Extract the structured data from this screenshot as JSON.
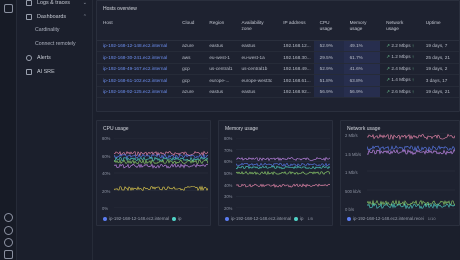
{
  "sidebar": {
    "items": [
      {
        "label": "Logs & traces",
        "chevron": "⌄"
      },
      {
        "label": "Dashboards",
        "chevron": "⌃"
      },
      {
        "label": "Cardinality"
      },
      {
        "label": "Connect remotely"
      },
      {
        "label": "Alerts"
      },
      {
        "label": "AI SRE"
      }
    ]
  },
  "hosts": {
    "title": "Hosts overview",
    "columns": [
      "Host",
      "Cloud",
      "Region",
      "Availability zone",
      "IP address",
      "CPU usage",
      "Memory usage",
      "Network usage",
      "Uptime"
    ],
    "rows": [
      {
        "host": "ip-192-168-12-148.ec2.internal",
        "cloud": "azure",
        "region": "eastus",
        "az": "eastus",
        "ip": "192.168.12...",
        "cpu": "52.9%",
        "mem": "49.1%",
        "net": "2.2 Mbps",
        "uptime": "19 days, 7"
      },
      {
        "host": "ip-192-168-30-241.ec2.internal",
        "cloud": "aws",
        "region": "eu-west-1",
        "az": "eu-west-1a",
        "ip": "192.168.30...",
        "cpu": "29.5%",
        "mem": "61.7%",
        "net": "1.2 Mbps",
        "uptime": "25 days, 21"
      },
      {
        "host": "ip-192-168-49-167.ec2.internal",
        "cloud": "gcp",
        "region": "us-central1",
        "az": "us-central1b",
        "ip": "192.168.49...",
        "cpu": "52.9%",
        "mem": "41.6%",
        "net": "2.4 Mbps",
        "uptime": "19 days, 2"
      },
      {
        "host": "ip-192-168-61-102.ec2.internal",
        "cloud": "gcp",
        "region": "europe-...",
        "az": "europe-west3c",
        "ip": "192.168.61...",
        "cpu": "51.8%",
        "mem": "63.8%",
        "net": "1.4 Mbps",
        "uptime": "3 days, 17"
      },
      {
        "host": "ip-192-168-92-125.ec2.internal",
        "cloud": "azure",
        "region": "eastus",
        "az": "eastus",
        "ip": "192.168.92...",
        "cpu": "56.9%",
        "mem": "56.9%",
        "net": "2.6 Mbps",
        "uptime": "19 days, 21"
      }
    ]
  },
  "cpu_chart": {
    "title": "CPU usage",
    "yticks": [
      "80%",
      "60%",
      "40%",
      "20%",
      "0%"
    ],
    "legend": "ip-192-168-12-148.ec2.internal",
    "legend_more": "ip",
    "legend_page": "1/5"
  },
  "mem_chart": {
    "title": "Memory usage",
    "yticks": [
      "80%",
      "70%",
      "60%",
      "50%",
      "40%",
      "30%",
      "20%"
    ],
    "legend": "ip-192-168-12-148.ec2.internal",
    "legend_more": "ip",
    "legend_page": "1/5"
  },
  "net_chart": {
    "title": "Network usage",
    "yticks": [
      "2 Mb/s",
      "1.5 Mb/s",
      "1 Mb/s",
      "500 kb/s",
      "0 b/s"
    ],
    "legend": "ip-192-168-12-148.ec2.internal.recei",
    "legend_page": "1/10"
  },
  "colors": {
    "accent": "#6d8ff0",
    "series": [
      "#5b7cf0",
      "#4fd1c5",
      "#8fd16a",
      "#e8d24f",
      "#c98bf0",
      "#f08bb0"
    ],
    "up_arrow": "#6fcf97"
  }
}
